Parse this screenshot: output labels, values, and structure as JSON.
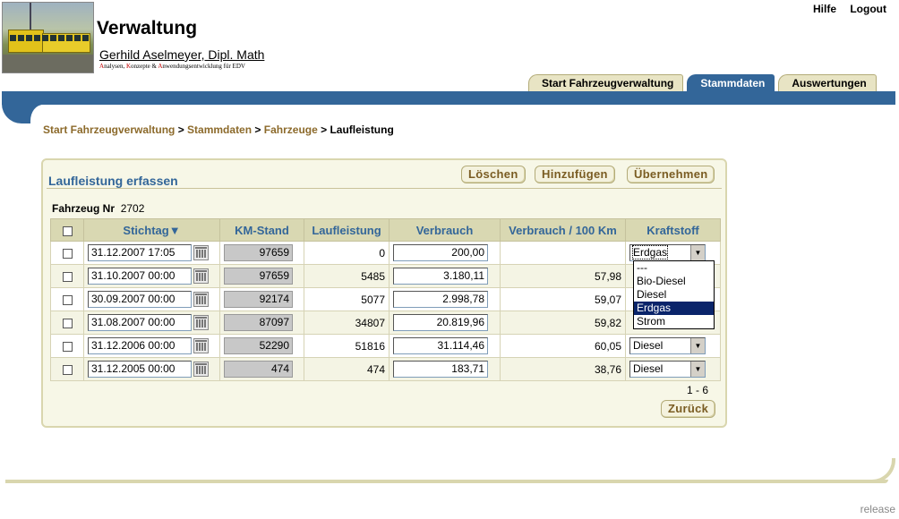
{
  "header": {
    "title": "Verwaltung",
    "user": "Gerhild Aselmeyer, Dipl. Math",
    "tagline_parts": [
      "A",
      "nalysen, ",
      "K",
      "onzepte & ",
      "A",
      "nwendungsentwicklung für EDV"
    ],
    "links": [
      "Hilfe",
      "Logout"
    ]
  },
  "tabs": [
    {
      "label": "Start Fahrzeugverwaltung",
      "active": false
    },
    {
      "label": "Stammdaten",
      "active": true
    },
    {
      "label": "Auswertungen",
      "active": false
    }
  ],
  "breadcrumb": {
    "items": [
      "Start Fahrzeugverwaltung",
      "Stammdaten",
      "Fahrzeuge"
    ],
    "separator": " > ",
    "current": "Laufleistung"
  },
  "panel": {
    "title": "Laufleistung erfassen",
    "buttons": {
      "delete": "Löschen",
      "add": "Hinzufügen",
      "apply": "Übernehmen",
      "back": "Zurück"
    },
    "vehicle_label": "Fahrzeug Nr",
    "vehicle_value": "2702",
    "pager": "1 - 6"
  },
  "table": {
    "columns": [
      "Stichtag▼",
      "KM-Stand",
      "Laufleistung",
      "Verbrauch",
      "Verbrauch / 100 Km",
      "Kraftstoff"
    ],
    "rows": [
      {
        "date": "31.12.2007 17:05",
        "km": "97659",
        "laufleistung": "0",
        "verbrauch": "200,00",
        "per100": "",
        "fuel": "Erdgas"
      },
      {
        "date": "31.10.2007 00:00",
        "km": "97659",
        "laufleistung": "5485",
        "verbrauch": "3.180,11",
        "per100": "57,98",
        "fuel": ""
      },
      {
        "date": "30.09.2007 00:00",
        "km": "92174",
        "laufleistung": "5077",
        "verbrauch": "2.998,78",
        "per100": "59,07",
        "fuel": ""
      },
      {
        "date": "31.08.2007 00:00",
        "km": "87097",
        "laufleistung": "34807",
        "verbrauch": "20.819,96",
        "per100": "59,82",
        "fuel": ""
      },
      {
        "date": "31.12.2006 00:00",
        "km": "52290",
        "laufleistung": "51816",
        "verbrauch": "31.114,46",
        "per100": "60,05",
        "fuel": "Diesel"
      },
      {
        "date": "31.12.2005 00:00",
        "km": "474",
        "laufleistung": "474",
        "verbrauch": "183,71",
        "per100": "38,76",
        "fuel": "Diesel"
      }
    ]
  },
  "dropdown": {
    "options": [
      "---",
      "Bio-Diesel",
      "Diesel",
      "Erdgas",
      "Strom"
    ],
    "selected": "Erdgas"
  },
  "footer": {
    "release": "release"
  }
}
